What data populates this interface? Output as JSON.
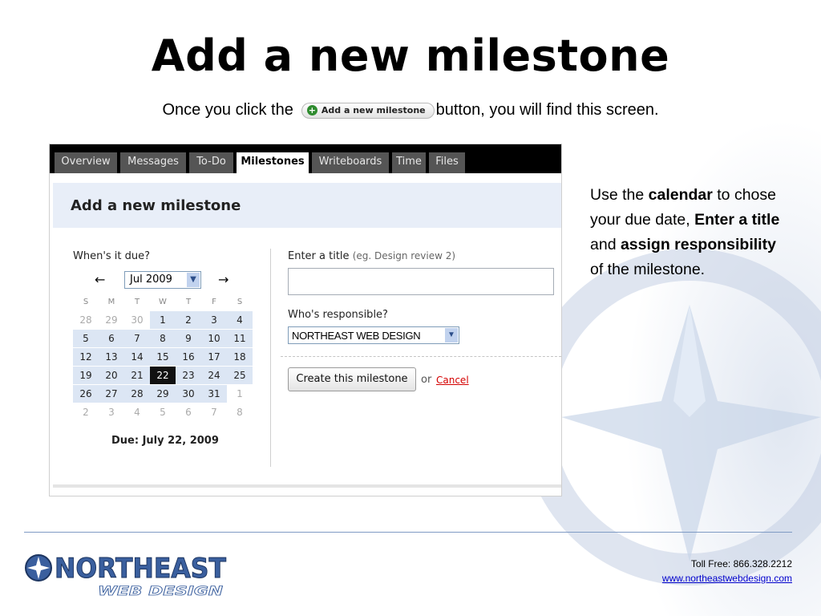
{
  "slide": {
    "title": "Add a new milestone",
    "subtitle_before": "Once you click the",
    "subtitle_button": "Add a new milestone",
    "subtitle_after": "button, you will find this screen."
  },
  "app": {
    "tabs": [
      "Overview",
      "Messages",
      "To-Do",
      "Milestones",
      "Writeboards",
      "Time",
      "Files"
    ],
    "active_tab": "Milestones",
    "panel_title": "Add a new milestone",
    "due_label": "When's it due?",
    "month_value": "Jul 2009",
    "prev_arrow": "←",
    "next_arrow": "→",
    "dow": [
      "S",
      "M",
      "T",
      "W",
      "T",
      "F",
      "S"
    ],
    "weeks": [
      [
        "28",
        "29",
        "30",
        "1",
        "2",
        "3",
        "4"
      ],
      [
        "5",
        "6",
        "7",
        "8",
        "9",
        "10",
        "11"
      ],
      [
        "12",
        "13",
        "14",
        "15",
        "16",
        "17",
        "18"
      ],
      [
        "19",
        "20",
        "21",
        "22",
        "23",
        "24",
        "25"
      ],
      [
        "26",
        "27",
        "28",
        "29",
        "30",
        "31",
        "1"
      ],
      [
        "2",
        "3",
        "4",
        "5",
        "6",
        "7",
        "8"
      ]
    ],
    "selected_day": "22",
    "due_text": "Due: July 22, 2009",
    "title_label": "Enter a title",
    "title_hint": "(eg. Design review 2)",
    "title_value": "",
    "responsible_label": "Who's responsible?",
    "responsible_value": "NORTHEAST WEB DESIGN",
    "create_button": "Create this milestone",
    "or_text": "or",
    "cancel_link": "Cancel"
  },
  "note": {
    "t1": "Use the ",
    "b1": "calendar",
    "t2": " to chose your due date, ",
    "b2": "Enter a title",
    "t3": " and ",
    "b3": "assign responsibility",
    "t4": " of the milestone."
  },
  "footer": {
    "toll_free_label": "Toll Free:",
    "phone": "866.328.2212",
    "website": "www.northeastwebdesign.com",
    "logo_main": "NORTHEAST",
    "logo_sub": "WEB DESIGN"
  },
  "colors": {
    "tab_bar": "#000000",
    "tab_active": "#ffffff",
    "panel_head": "#e8eef8",
    "calendar_fill": "#dce6f4",
    "selected_day": "#111111",
    "cancel": "#d40000",
    "logo_blue": "#3a5f9e"
  }
}
